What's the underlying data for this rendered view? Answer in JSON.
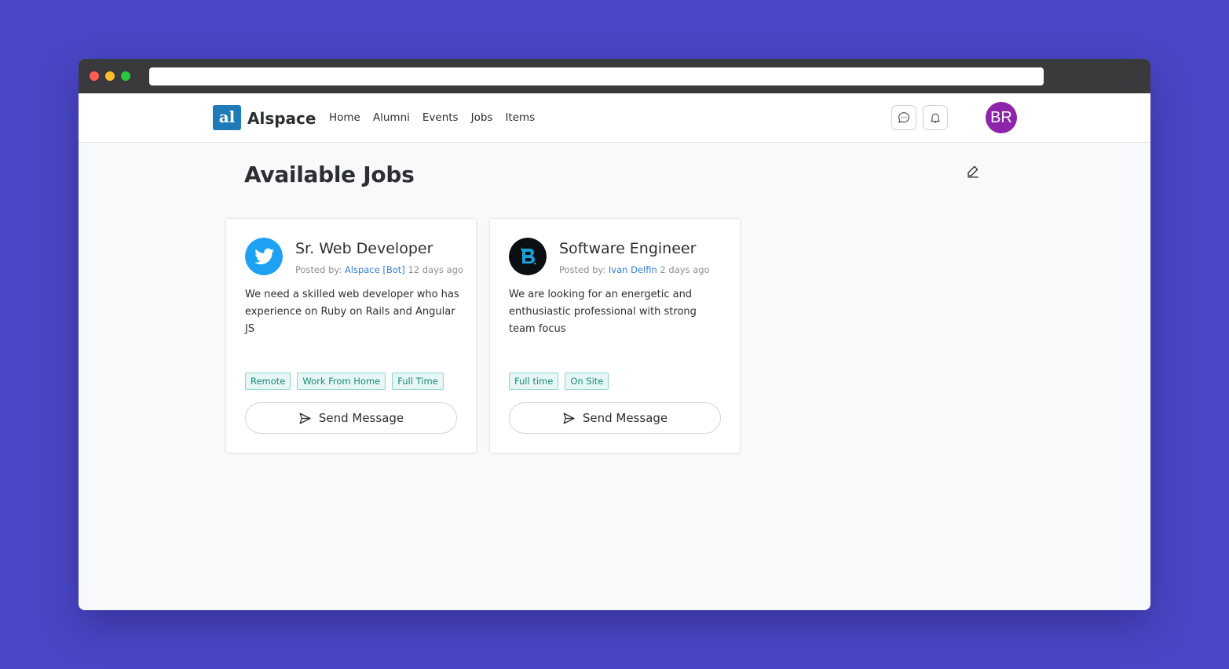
{
  "app": {
    "name": "Alspace",
    "logo_text": "al"
  },
  "nav": {
    "links": [
      "Home",
      "Alumni",
      "Events",
      "Jobs",
      "Items"
    ]
  },
  "header": {
    "avatar_initials": "BR",
    "avatar_color": "#8e24aa"
  },
  "page": {
    "title": "Available Jobs"
  },
  "jobs": [
    {
      "title": "Sr. Web Developer",
      "posted_by_label": "Posted by:",
      "poster": "Alspace [Bot]",
      "time_ago": "12 days ago",
      "description": "We need a skilled web developer who has experience on Ruby on Rails and Angular JS",
      "tags": [
        "Remote",
        "Work From Home",
        "Full Time"
      ],
      "logo_icon": "twitter-logo-icon",
      "button_label": "Send Message"
    },
    {
      "title": "Software Engineer",
      "posted_by_label": "Posted by:",
      "poster": "Ivan Delfin",
      "time_ago": "2 days ago",
      "description": "We are looking for an energetic and enthusiastic professional with strong team focus",
      "tags": [
        "Full time",
        "On Site"
      ],
      "logo_icon": "company-logo-icon",
      "button_label": "Send Message"
    }
  ],
  "colors": {
    "background": "#4a47c6",
    "accent": "#1f7ab8",
    "link": "#2e7fd6",
    "tag_text": "#1a8a7d"
  }
}
